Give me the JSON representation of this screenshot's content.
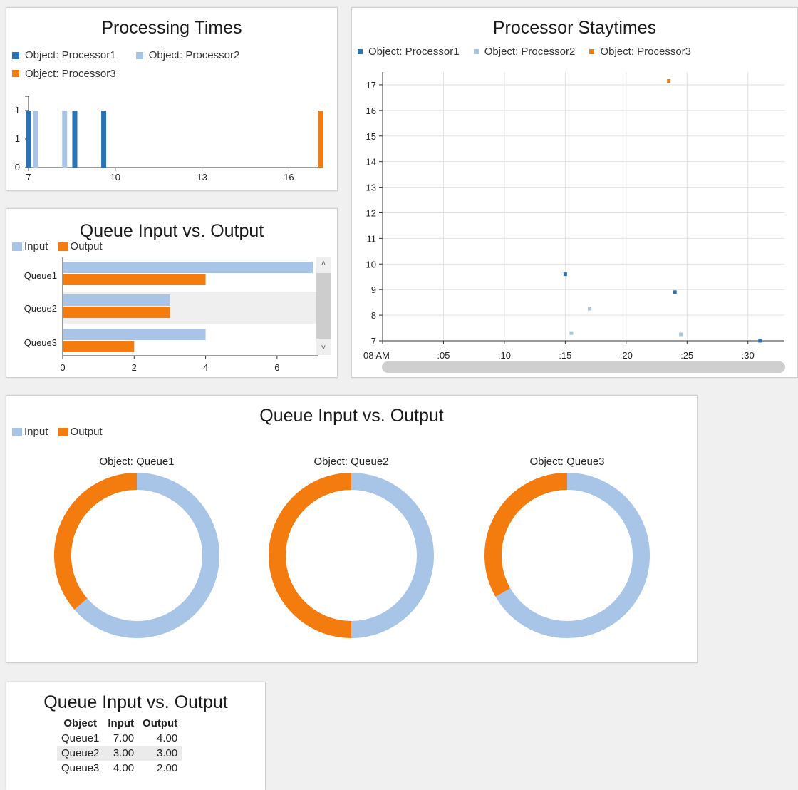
{
  "colors": {
    "processor1": "#2b73b4",
    "processor2": "#a8c4e6",
    "processor3": "#f47b0e",
    "input": "#a8c4e6",
    "output": "#f47b0e"
  },
  "chart_data": [
    {
      "id": "processing_times",
      "type": "bar",
      "title": "Processing Times",
      "legend": [
        "Object: Processor1",
        "Object: Processor2",
        "Object: Processor3"
      ],
      "xlim": [
        7,
        17
      ],
      "xticks": [
        7,
        10,
        13,
        16
      ],
      "ylim": [
        0,
        1
      ],
      "yticks": [
        0,
        1,
        1
      ],
      "series": [
        {
          "name": "Object: Processor1",
          "x": [
            7.0,
            8.6,
            9.6
          ],
          "values": [
            1,
            1,
            1
          ]
        },
        {
          "name": "Object: Processor2",
          "x": [
            7.25,
            8.25
          ],
          "values": [
            1,
            1
          ]
        },
        {
          "name": "Object: Processor3",
          "x": [
            17.1
          ],
          "values": [
            1
          ]
        }
      ]
    },
    {
      "id": "processor_staytimes",
      "type": "scatter",
      "title": "Processor Staytimes",
      "legend": [
        "Object: Processor1",
        "Object: Processor2",
        "Object: Processor3"
      ],
      "xticks": [
        "08 AM",
        ":05",
        ":10",
        ":15",
        ":20",
        ":25",
        ":30"
      ],
      "xlim": [
        "08:00",
        "08:33"
      ],
      "ylim": [
        7,
        17.5
      ],
      "yticks": [
        7,
        8,
        9,
        10,
        11,
        12,
        13,
        14,
        15,
        16,
        17
      ],
      "grid": true,
      "series": [
        {
          "name": "Object: Processor1",
          "points": [
            [
              "08:15",
              9.6
            ],
            [
              "08:24",
              8.9
            ],
            [
              "08:31",
              7.0
            ]
          ]
        },
        {
          "name": "Object: Processor2",
          "points": [
            [
              "08:17",
              8.25
            ],
            [
              "08:24.5",
              7.25
            ],
            [
              "08:15.5",
              7.3
            ]
          ]
        },
        {
          "name": "Object: Processor3",
          "points": [
            [
              "08:23.5",
              17.15
            ]
          ]
        }
      ]
    },
    {
      "id": "queue_bar",
      "type": "bar",
      "orientation": "horizontal",
      "title": "Queue Input vs. Output",
      "legend": [
        "Input",
        "Output"
      ],
      "categories": [
        "Queue1",
        "Queue2",
        "Queue3"
      ],
      "xlim": [
        0,
        7
      ],
      "xticks": [
        0,
        2,
        4,
        6
      ],
      "series": [
        {
          "name": "Input",
          "values": [
            7,
            3,
            4
          ]
        },
        {
          "name": "Output",
          "values": [
            4,
            3,
            2
          ]
        }
      ]
    },
    {
      "id": "queue_donuts",
      "type": "pie",
      "title": "Queue Input vs. Output",
      "legend": [
        "Input",
        "Output"
      ],
      "pies": [
        {
          "label": "Object: Queue1",
          "input": 7,
          "output": 4
        },
        {
          "label": "Object: Queue2",
          "input": 3,
          "output": 3
        },
        {
          "label": "Object: Queue3",
          "input": 4,
          "output": 2
        }
      ]
    },
    {
      "id": "queue_table",
      "type": "table",
      "title": "Queue Input vs. Output",
      "columns": [
        "Object",
        "Input",
        "Output"
      ],
      "rows": [
        [
          "Queue1",
          "7.00",
          "4.00"
        ],
        [
          "Queue2",
          "3.00",
          "3.00"
        ],
        [
          "Queue3",
          "4.00",
          "2.00"
        ]
      ]
    }
  ]
}
